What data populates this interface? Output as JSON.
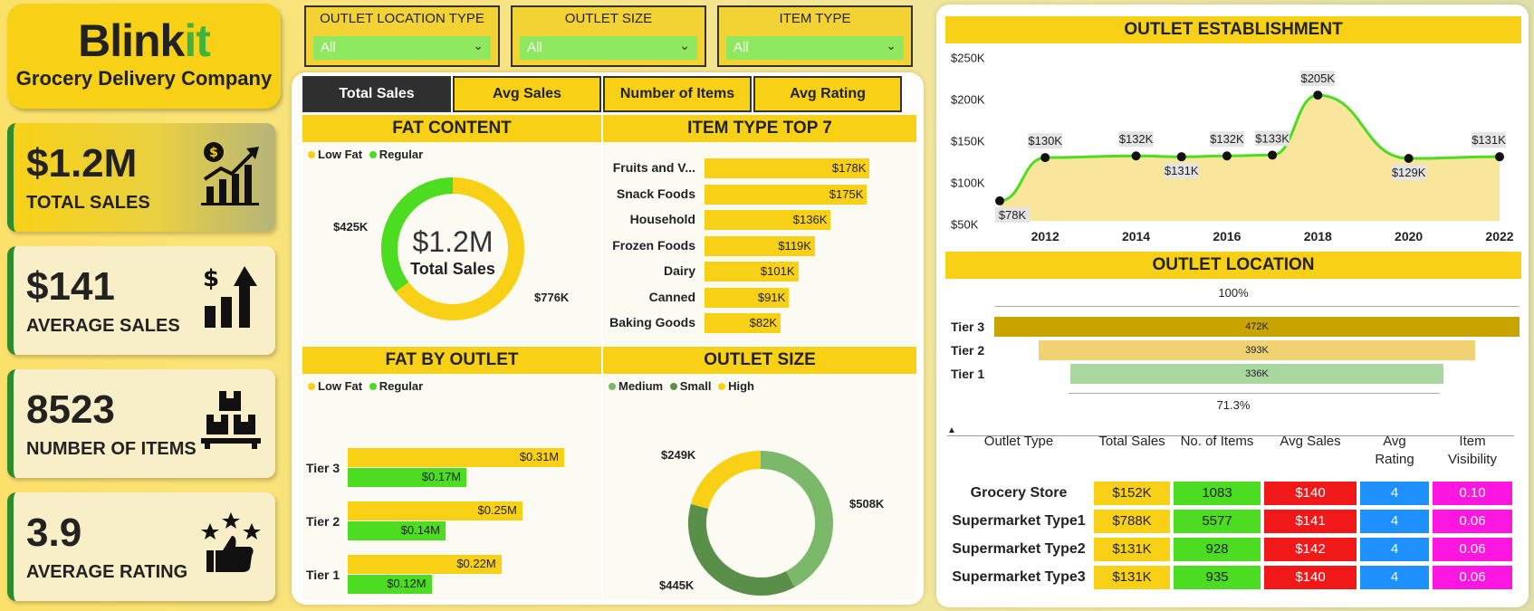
{
  "logo": {
    "brand_main": "Blink",
    "brand_accent": "it",
    "subtitle": "Grocery Delivery Company"
  },
  "kpis": [
    {
      "value": "$1.2M",
      "label": "TOTAL SALES",
      "icon": "growth-chart-icon"
    },
    {
      "value": "$141",
      "label": "AVERAGE SALES",
      "icon": "dollar-bars-icon"
    },
    {
      "value": "8523",
      "label": "NUMBER OF ITEMS",
      "icon": "boxes-icon"
    },
    {
      "value": "3.9",
      "label": "AVERAGE RATING",
      "icon": "stars-thumb-icon"
    }
  ],
  "slicers": [
    {
      "title": "OUTLET LOCATION TYPE",
      "value": "All"
    },
    {
      "title": "OUTLET SIZE",
      "value": "All"
    },
    {
      "title": "ITEM TYPE",
      "value": "All"
    }
  ],
  "tabs": [
    "Total Sales",
    "Avg Sales",
    "Number of Items",
    "Avg Rating"
  ],
  "colors": {
    "yellow": "#f8d117",
    "green": "#4cdc22",
    "dark": "#2f2f2f",
    "med": "#7cb86a",
    "small": "#5a8f4a",
    "tier3": "#c8a400",
    "tier2": "#efd272",
    "tier1": "#a8d8a0"
  },
  "fat_content": {
    "title": "FAT CONTENT",
    "legend": [
      "Low Fat",
      "Regular"
    ],
    "center_value": "$1.2M",
    "center_label": "Total Sales",
    "chart_data": {
      "type": "pie",
      "categories": [
        "Low Fat",
        "Regular"
      ],
      "values": [
        776,
        425
      ],
      "labels": [
        "$776K",
        "$425K"
      ]
    }
  },
  "item_top7": {
    "title": "ITEM TYPE TOP 7",
    "chart_data": {
      "type": "bar",
      "categories": [
        "Fruits and V...",
        "Snack Foods",
        "Household",
        "Frozen Foods",
        "Dairy",
        "Canned",
        "Baking Goods"
      ],
      "values": [
        178,
        175,
        136,
        119,
        101,
        91,
        82
      ],
      "labels": [
        "$178K",
        "$175K",
        "$136K",
        "$119K",
        "$101K",
        "$91K",
        "$82K"
      ]
    }
  },
  "fat_by_outlet": {
    "title": "FAT BY OUTLET",
    "legend": [
      "Low Fat",
      "Regular"
    ],
    "chart_data": {
      "type": "bar",
      "categories": [
        "Tier 3",
        "Tier 2",
        "Tier 1"
      ],
      "series": [
        {
          "name": "Low Fat",
          "values": [
            0.31,
            0.25,
            0.22
          ],
          "labels": [
            "$0.31M",
            "$0.25M",
            "$0.22M"
          ]
        },
        {
          "name": "Regular",
          "values": [
            0.17,
            0.14,
            0.12
          ],
          "labels": [
            "$0.17M",
            "$0.14M",
            "$0.12M"
          ]
        }
      ]
    }
  },
  "outlet_size": {
    "title": "OUTLET SIZE",
    "legend": [
      "Medium",
      "Small",
      "High"
    ],
    "chart_data": {
      "type": "pie",
      "categories": [
        "Medium",
        "Small",
        "High"
      ],
      "values": [
        508,
        445,
        249
      ],
      "labels": [
        "$508K",
        "$445K",
        "$249K"
      ]
    }
  },
  "establishment": {
    "title": "OUTLET ESTABLISHMENT",
    "chart_data": {
      "type": "area",
      "x": [
        2011,
        2012,
        2014,
        2015,
        2016,
        2017,
        2018,
        2020,
        2022
      ],
      "values": [
        78,
        130,
        132,
        131,
        132,
        133,
        205,
        129,
        131
      ],
      "labels": [
        "$78K",
        "$130K",
        "$132K",
        "$131K",
        "$132K",
        "$133K",
        "$205K",
        "$129K",
        "$131K"
      ],
      "yticks": [
        "$50K",
        "$100K",
        "$150K",
        "$200K",
        "$250K"
      ],
      "xticks": [
        "2012",
        "2014",
        "2016",
        "2018",
        "2020",
        "2022"
      ],
      "ylim": [
        50,
        250
      ]
    }
  },
  "location": {
    "title": "OUTLET LOCATION",
    "top_pct": "100%",
    "bottom_pct": "71.3%",
    "chart_data": {
      "type": "bar",
      "categories": [
        "Tier 3",
        "Tier 2",
        "Tier 1"
      ],
      "values": [
        472,
        393,
        336
      ],
      "labels": [
        "472K",
        "393K",
        "336K"
      ]
    }
  },
  "table": {
    "headers": [
      "Outlet Type",
      "Total Sales",
      "No. of Items",
      "Avg Sales",
      "Avg\nRating",
      "Item\nVisibility"
    ],
    "sort_arrow": "▲",
    "rows": [
      {
        "type": "Grocery Store",
        "sales": "$152K",
        "items": "1083",
        "avg": "$140",
        "rating": "4",
        "vis": "0.10"
      },
      {
        "type": "Supermarket Type1",
        "sales": "$788K",
        "items": "5577",
        "avg": "$141",
        "rating": "4",
        "vis": "0.06"
      },
      {
        "type": "Supermarket Type2",
        "sales": "$131K",
        "items": "928",
        "avg": "$142",
        "rating": "4",
        "vis": "0.06"
      },
      {
        "type": "Supermarket Type3",
        "sales": "$131K",
        "items": "935",
        "avg": "$140",
        "rating": "4",
        "vis": "0.06"
      }
    ]
  }
}
